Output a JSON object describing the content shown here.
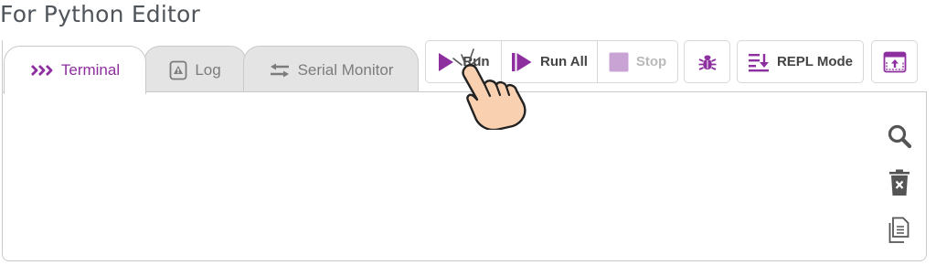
{
  "heading": "For Python Editor",
  "tabs": [
    {
      "label": "Terminal",
      "icon": "chevrons-right-icon",
      "active": true
    },
    {
      "label": "Log",
      "icon": "document-warning-icon",
      "active": false
    },
    {
      "label": "Serial Monitor",
      "icon": "arrows-left-right-icon",
      "active": false
    }
  ],
  "toolbar": {
    "run_label": "Run",
    "run_all_label": "Run All",
    "stop_label": "Stop",
    "repl_label": "REPL Mode"
  },
  "side_icons": [
    "search-icon",
    "trash-icon",
    "copy-icon"
  ],
  "colors": {
    "accent": "#8d2f9e",
    "accent_light": "#c9a3d4",
    "tab_inactive_bg": "#e4e4e4",
    "tab_inactive_text": "#7c7c7c",
    "disabled_text": "#b9b9b9",
    "border": "#c9c9c9"
  }
}
